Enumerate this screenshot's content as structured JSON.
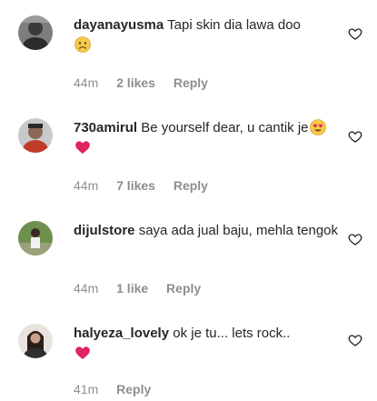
{
  "comments": [
    {
      "username": "dayanayusma",
      "text": "Tapi skin dia lawa doo",
      "emojis": [
        "worried-face-emoji"
      ],
      "time": "44m",
      "likes": "2 likes",
      "reply": "Reply"
    },
    {
      "username": "730amirul",
      "text": "Be yourself dear, u cantik je",
      "emojis": [
        "heart-eyes-emoji",
        "red-heart-emoji"
      ],
      "time": "44m",
      "likes": "7 likes",
      "reply": "Reply"
    },
    {
      "username": "dijulstore",
      "text": "saya ada jual baju, mehla tengok",
      "emojis": [],
      "time": "44m",
      "likes": "1 like",
      "reply": "Reply"
    },
    {
      "username": "halyeza_lovely",
      "text": "ok je tu... lets rock..",
      "emojis": [
        "red-heart-emoji"
      ],
      "time": "41m",
      "likes": "",
      "reply": "Reply"
    }
  ],
  "icons": {
    "like": "heart-outline-icon"
  },
  "colors": {
    "text": "#262626",
    "meta": "#8e8e8e",
    "heart": "#e0245e",
    "emoji_face": "#f7c948"
  }
}
